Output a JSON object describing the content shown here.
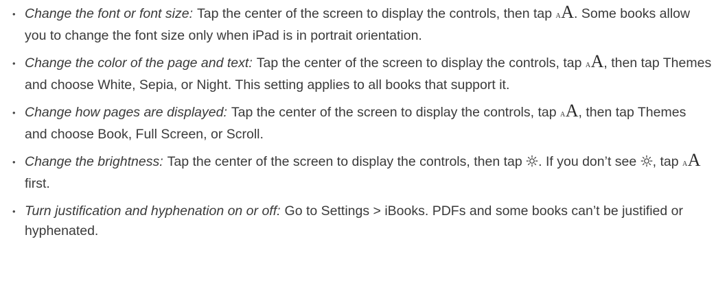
{
  "bullet_glyph": "•",
  "icons": {
    "font_size_icon": "aA-font-icon",
    "brightness_icon": "sun-icon",
    "font_icon_small_letter": "A",
    "font_icon_large_letter": "A"
  },
  "items": [
    {
      "lead": "Change the font or font size:",
      "text_1": "Tap the center of the screen to display the controls, then tap",
      "text_2": ". Some books allow you to change the font size only when iPad is in portrait orientation."
    },
    {
      "lead": "Change the color of the page and text:",
      "text_1": "Tap the center of the screen to display the controls, tap",
      "text_2": ", then tap Themes and choose White, Sepia, or Night. This setting applies to all books that support it."
    },
    {
      "lead": "Change how pages are displayed:",
      "text_1": "Tap the center of the screen to display the controls, tap",
      "text_2": ", then tap Themes and choose Book, Full Screen, or Scroll."
    },
    {
      "lead": "Change the brightness:",
      "text_1": "Tap the center of the screen to display the controls, then tap",
      "text_2": ". If you don’t see",
      "text_3": ", tap",
      "text_4": "first."
    },
    {
      "lead": "Turn justification and hyphenation on or off:",
      "text_1": "Go to Settings > iBooks. PDFs and some books can’t be justified or hyphenated."
    }
  ]
}
